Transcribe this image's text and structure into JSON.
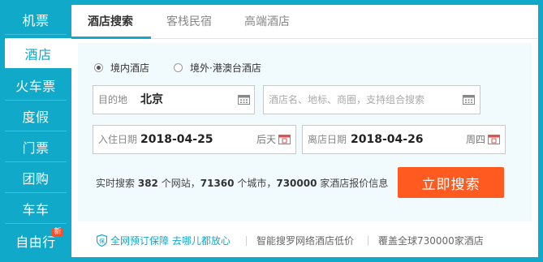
{
  "nav": {
    "items": [
      {
        "label": "机票"
      },
      {
        "label": "酒店"
      },
      {
        "label": "火车票"
      },
      {
        "label": "度假"
      },
      {
        "label": "门票"
      },
      {
        "label": "团购"
      },
      {
        "label": "车车"
      },
      {
        "label": "自由行",
        "badge": "新"
      }
    ],
    "active_index": 1
  },
  "tabs": [
    {
      "label": "酒店搜索"
    },
    {
      "label": "客栈民宿"
    },
    {
      "label": "高端酒店"
    }
  ],
  "radios": [
    {
      "label": "境内酒店",
      "checked": true
    },
    {
      "label": "境外·港澳台酒店",
      "checked": false
    }
  ],
  "destination": {
    "label": "目的地",
    "value": "北京"
  },
  "keyword": {
    "placeholder": "酒店名、地标、商圈，支持组合搜索"
  },
  "checkin": {
    "label": "入住日期",
    "value": "2018-04-25",
    "weekday": "后天"
  },
  "checkout": {
    "label": "离店日期",
    "value": "2018-04-26",
    "weekday": "周四"
  },
  "stats": {
    "prefix": "实时搜索",
    "sites": "382",
    "sites_unit": "个网站，",
    "cities": "71360",
    "cities_unit": "个城市，",
    "quotes": "730000",
    "quotes_unit": "家酒店报价信息"
  },
  "search_button": "立即搜索",
  "footer": {
    "guarantee": "全网预订保障 去哪儿都放心",
    "smart": "智能搜罗网络酒店低价",
    "coverage": "覆盖全球730000家酒店"
  },
  "colors": {
    "brand": "#10a9c9",
    "button": "#ff5a1f",
    "form_bg": "#f1fafc"
  },
  "icons": [
    "calendar-icon",
    "shield-icon"
  ]
}
